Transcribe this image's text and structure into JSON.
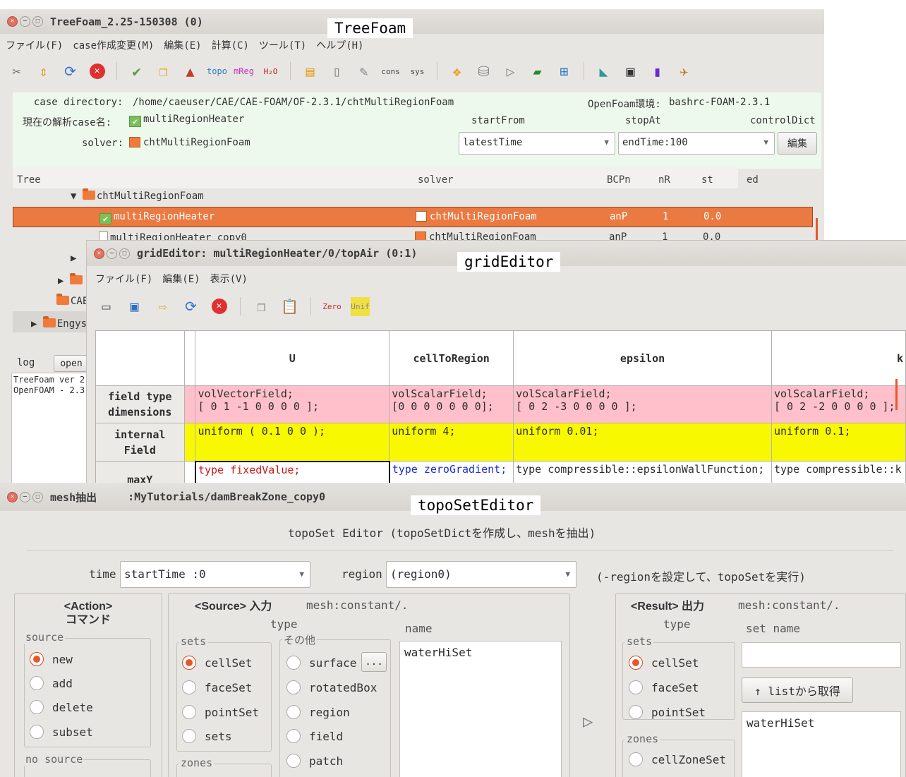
{
  "treefoam": {
    "title": "TreeFoam_2.25-150308 (0)",
    "tag": "TreeFoam",
    "menu": [
      "ファイル(F)",
      "case作成変更(M)",
      "編集(E)",
      "計算(C)",
      "ツール(T)",
      "ヘルプ(H)"
    ],
    "case_directory_label": "case directory:",
    "case_directory": "/home/caeuser/CAE/CAE-FOAM/OF-2.3.1/chtMultiRegionFoam",
    "env_label": "OpenFoam環境:",
    "env_value": "bashrc-FOAM-2.3.1",
    "current_case_label": "現在の解析case名:",
    "current_case": "multiRegionHeater",
    "solver_label": "solver:",
    "solver": "chtMultiRegionFoam",
    "startFrom_label": "startFrom",
    "startFrom_value": "latestTime",
    "stopAt_label": "stopAt",
    "stopAt_value": "endTime:100",
    "controlDict_label": "controlDict",
    "edit_button": "編集",
    "tree_header": {
      "tree": "Tree",
      "solver": "solver",
      "bcpn": "BCPn",
      "nr": "nR",
      "st": "st",
      "ed": "ed"
    },
    "tree_rows": [
      {
        "name": "chtMultiRegionFoam",
        "solver": "",
        "bcpn": "",
        "nr": "",
        "st": ""
      },
      {
        "name": "multiRegionHeater",
        "solver": "chtMultiRegionFoam",
        "bcpn": "anP",
        "nr": "1",
        "st": "0.0"
      },
      {
        "name": "multiRegionHeater_copy0",
        "solver": "chtMultiRegionFoam",
        "bcpn": "anP",
        "nr": "1",
        "st": "0.0"
      }
    ],
    "left_items": [
      "CAE",
      "Engys"
    ],
    "log_label": "log",
    "open_button": "open",
    "log_lines": [
      "TreeFoam ver 2",
      "OpenFOAM - 2.3"
    ]
  },
  "grideditor": {
    "title": "gridEditor: multiRegionHeater/0/topAir (0:1)",
    "tag": "gridEditor",
    "menu": [
      "ファイル(F)",
      "編集(E)",
      "表示(V)"
    ],
    "columns": [
      "U",
      "cellToRegion",
      "epsilon",
      "k"
    ],
    "rows": {
      "field_type_label_1": "field type",
      "field_type_label_2": "dimensions",
      "internal_label_1": "internal",
      "internal_label_2": "Field",
      "maxy_label": "maxY"
    },
    "field_types": [
      "volVectorField;",
      "volScalarField;",
      "volScalarField;",
      "volScalarField;"
    ],
    "dimensions": [
      "[ 0 1 -1 0 0 0 0 ];",
      "[0 0 0 0 0 0 0];",
      "[ 0 2 -3 0 0 0 0 ];",
      "[ 0 2 -2 0 0 0 0 ];"
    ],
    "internal": [
      "uniform ( 0.1 0 0 );",
      "uniform 4;",
      "uniform 0.01;",
      "uniform 0.1;"
    ],
    "maxy": [
      "type fixedValue;",
      "type zeroGradient;",
      "type compressible::epsilonWallFunction;",
      "type compressible::k"
    ]
  },
  "toposet": {
    "title": "mesh抽出",
    "path": ":MyTutorials/damBreakZone_copy0",
    "tag": "topoSetEditor",
    "heading": "topoSet Editor (topoSetDictを作成し、meshを抽出)",
    "time_label": "time",
    "time_value": "startTime :0",
    "region_label": "region",
    "region_value": "(region0)",
    "region_hint": "(-regionを設定して、topoSetを実行)",
    "action_title_1": "<Action>",
    "action_title_2": "コマンド",
    "source_group": "source",
    "actions": [
      "new",
      "add",
      "delete",
      "subset"
    ],
    "no_source_group": "no source",
    "source_title": "<Source> 入力",
    "source_mesh": "mesh:constant/.",
    "type_label": "type",
    "name_label": "name",
    "sets_group": "sets",
    "source_sets": [
      "cellSet",
      "faceSet",
      "pointSet",
      "sets"
    ],
    "zones_group": "zones",
    "other_group": "その他",
    "other_items": [
      "surface",
      "rotatedBox",
      "region",
      "field",
      "patch"
    ],
    "dots_button": "...",
    "source_names": [
      "waterHiSet"
    ],
    "result_title": "<Result> 出力",
    "result_mesh": "mesh:constant/.",
    "set_name_label": "set name",
    "result_sets": [
      "cellSet",
      "faceSet",
      "pointSet"
    ],
    "result_zones": [
      "cellZoneSet"
    ],
    "get_from_list_button": "↑ listから取得",
    "result_names": [
      "waterHiSet"
    ],
    "run_arrow": "▷"
  }
}
